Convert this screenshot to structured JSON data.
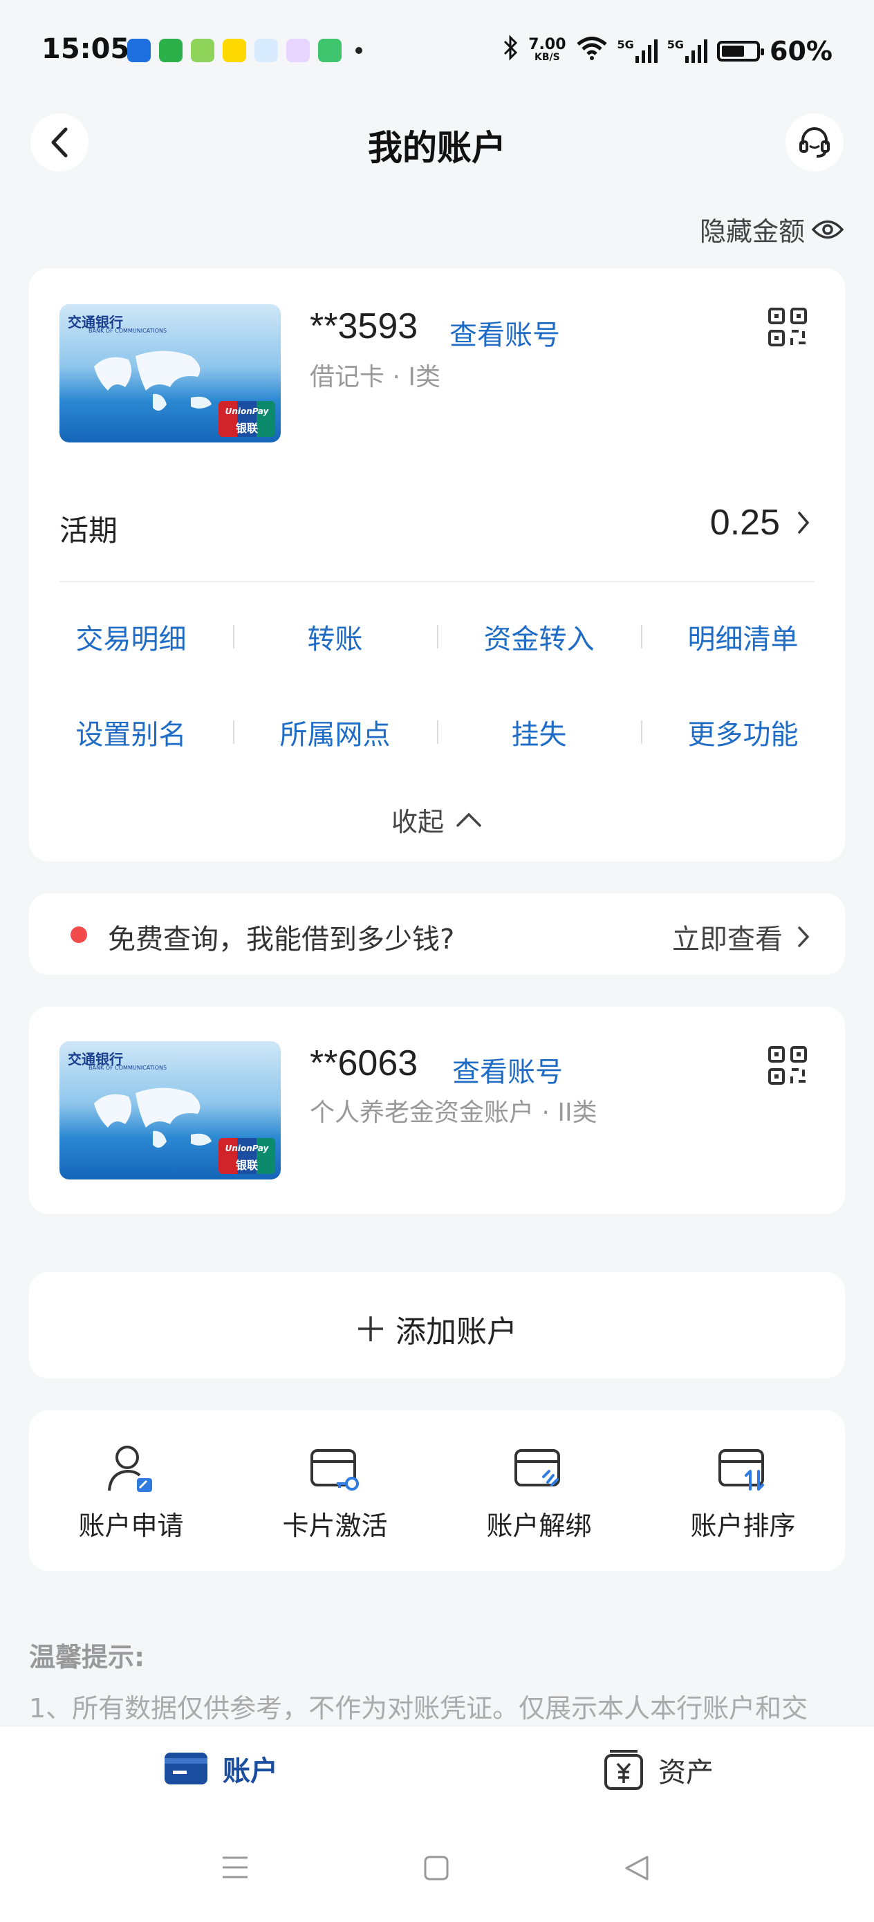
{
  "status_bar": {
    "time": "15:05",
    "net_speed_value": "7.00",
    "net_speed_unit": "KB/S",
    "signal1": "5G",
    "signal2": "5G",
    "battery": "60%"
  },
  "header": {
    "title": "我的账户"
  },
  "hide_amount_label": "隐藏金额",
  "account1": {
    "number": "**3593",
    "view_label": "查看账号",
    "type": "借记卡 · I类",
    "balance_label": "活期",
    "balance": "0.25",
    "actions_row1": [
      "交易明细",
      "转账",
      "资金转入",
      "明细清单"
    ],
    "actions_row2": [
      "设置别名",
      "所属网点",
      "挂失",
      "更多功能"
    ],
    "collapse_label": "收起"
  },
  "promo": {
    "text": "免费查询，我能借到多少钱?",
    "link": "立即查看"
  },
  "account2": {
    "number": "**6063",
    "view_label": "查看账号",
    "type": "个人养老金资金账户 · II类"
  },
  "add_account_label": "添加账户",
  "tools": [
    "账户申请",
    "卡片激活",
    "账户解绑",
    "账户排序"
  ],
  "tips": {
    "title": "温馨提示:",
    "line1": "1、所有数据仅供参考，不作为对账凭证。仅展示本人本行账户和交"
  },
  "bottom_nav": {
    "accounts": "账户",
    "assets": "资产"
  },
  "card_brand": {
    "bank_name": "交通银行",
    "bank_en": "BANK OF COMMUNICATIONS",
    "unionpay": "UnionPay",
    "unionpay_cn": "银联"
  },
  "colors": {
    "accent": "#1f6cc7",
    "nav_active": "#1a4d9e",
    "promo_dot": "#f24b4b"
  }
}
